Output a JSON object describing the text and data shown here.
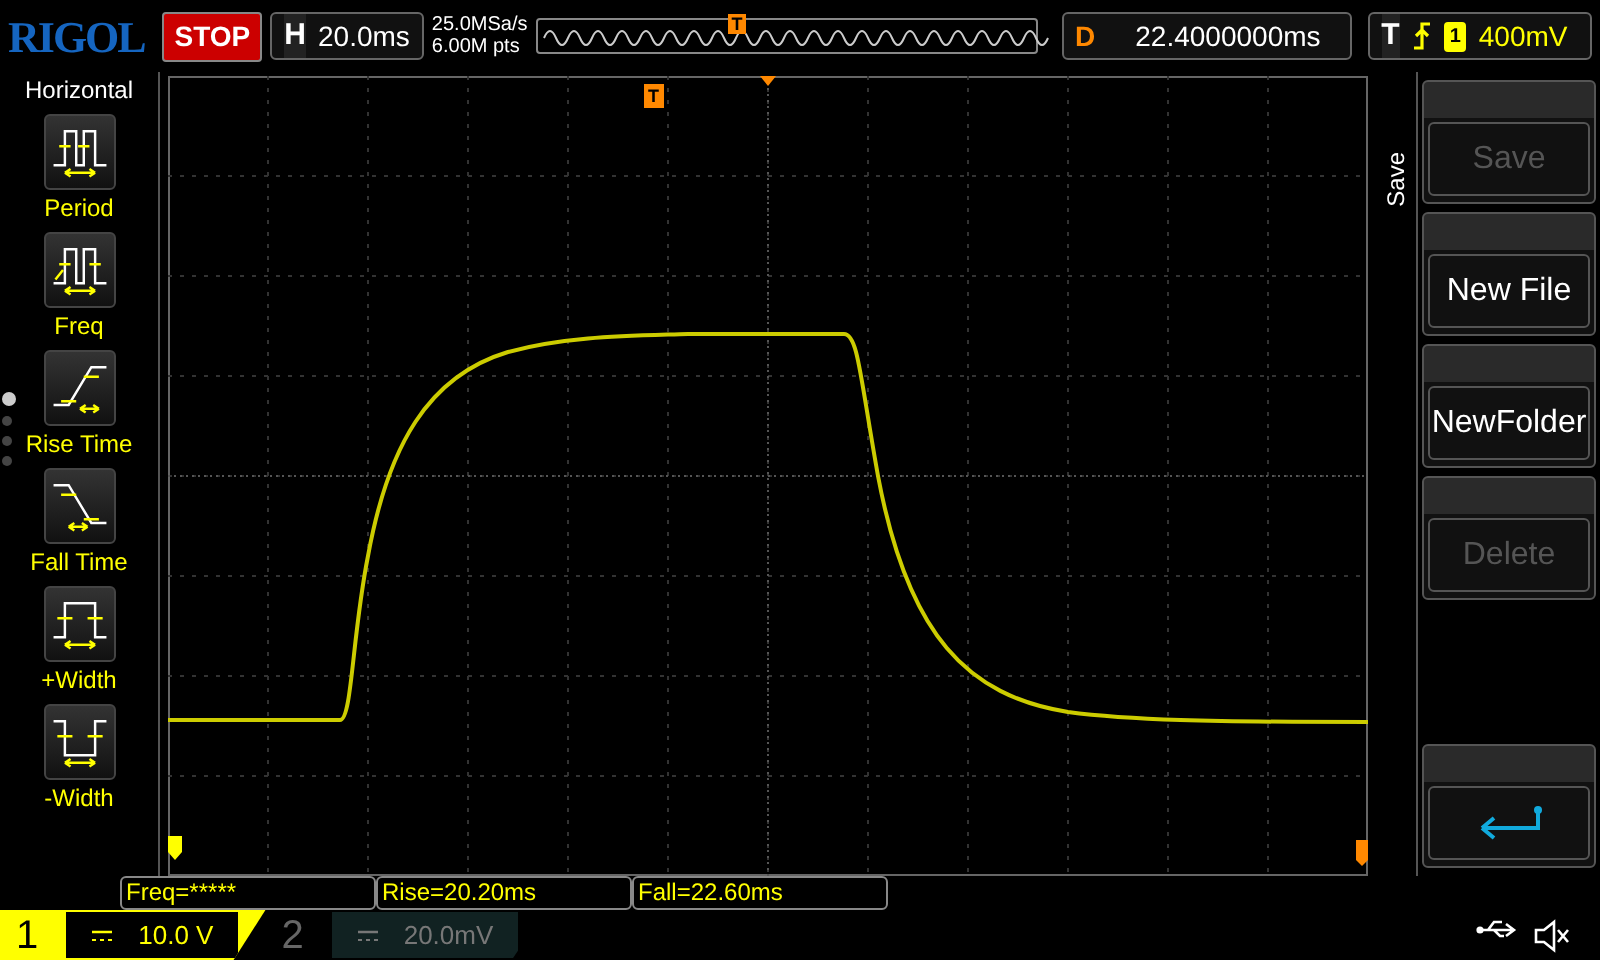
{
  "brand": "RIGOL",
  "run_state": "STOP",
  "horizontal": {
    "label": "H",
    "timebase": "20.0ms"
  },
  "sample_rate": "25.0MSa/s",
  "memory_depth": "6.00M pts",
  "timeline_marker": "T",
  "trigger_marker": "T",
  "delay": {
    "label": "D",
    "value": "22.4000000ms"
  },
  "trigger": {
    "label": "T",
    "source": "1",
    "level": "400mV"
  },
  "measure_menu": {
    "title": "Horizontal",
    "items": [
      {
        "label": "Period",
        "kind": "period"
      },
      {
        "label": "Freq",
        "kind": "freq"
      },
      {
        "label": "Rise Time",
        "kind": "rise"
      },
      {
        "label": "Fall Time",
        "kind": "fall"
      },
      {
        "label": "+Width",
        "kind": "pwidth"
      },
      {
        "label": "-Width",
        "kind": "nwidth"
      }
    ]
  },
  "menu_pages": [
    {
      "selected": true
    },
    {
      "selected": false
    },
    {
      "selected": false
    },
    {
      "selected": false
    }
  ],
  "softkeys": {
    "title": "Save",
    "buttons": [
      {
        "kind": "text",
        "label": "Save",
        "disabled": true
      },
      {
        "kind": "text",
        "label": "New File",
        "disabled": false
      },
      {
        "kind": "text",
        "label": "NewFolder",
        "disabled": false
      },
      {
        "kind": "text",
        "label": "Delete",
        "disabled": true
      },
      {
        "kind": "back"
      }
    ]
  },
  "measurements": [
    "Freq=*****",
    "Rise=20.20ms",
    "Fall=22.60ms"
  ],
  "channels": [
    {
      "number": "1",
      "scale": "10.0 V",
      "on": true
    },
    {
      "number": "2",
      "scale": "20.0mV",
      "on": false
    }
  ]
}
